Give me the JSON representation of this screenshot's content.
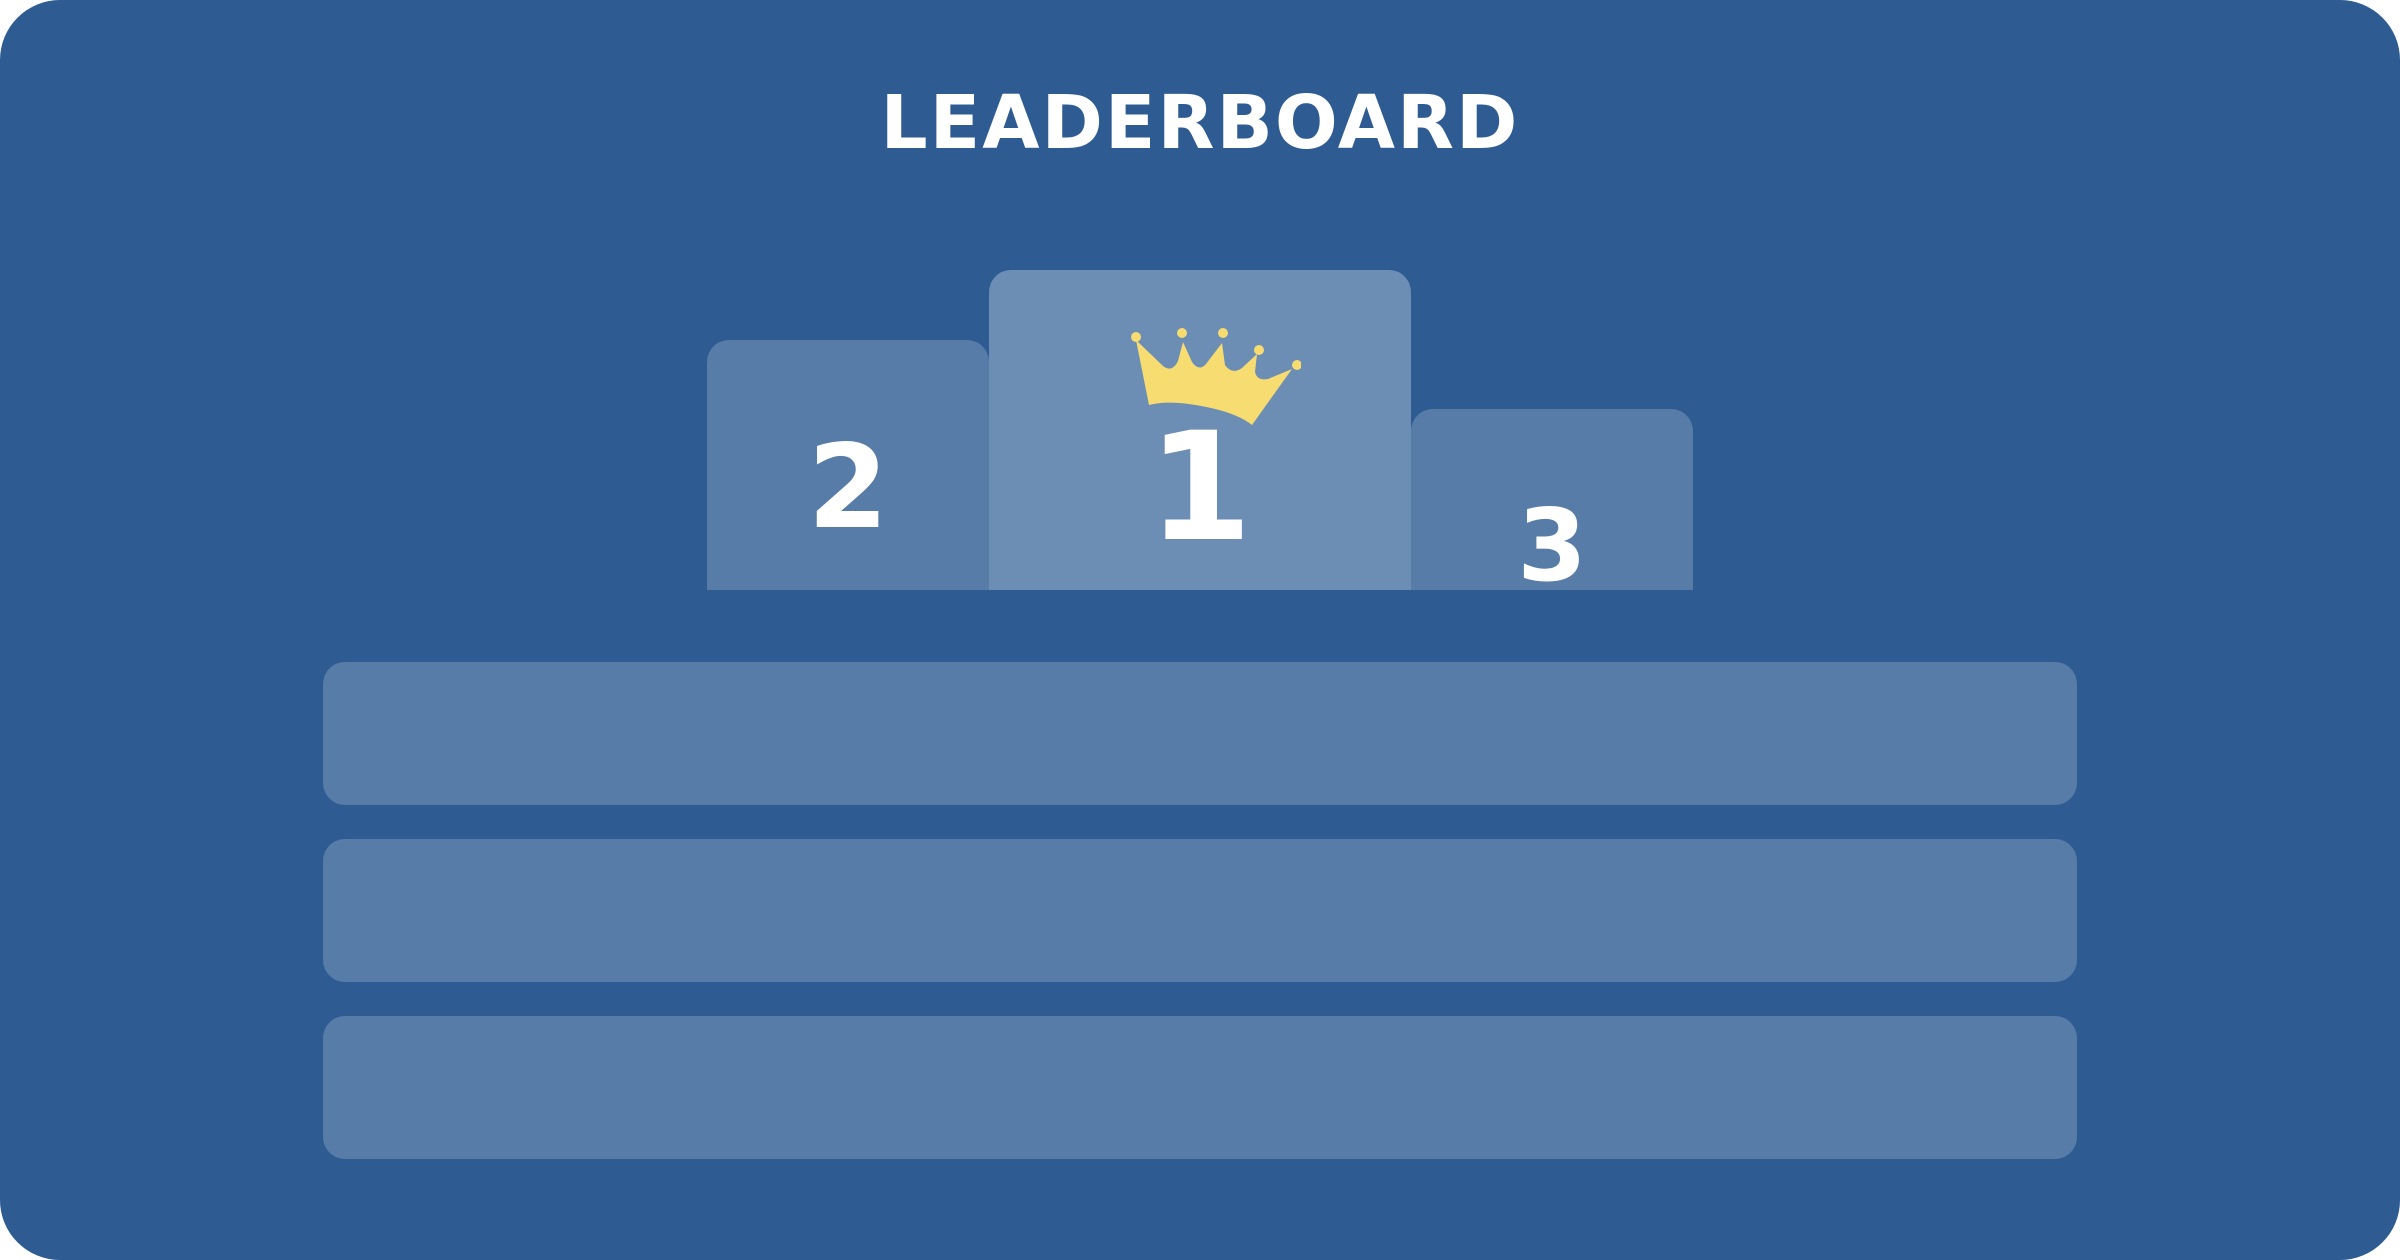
{
  "header": {
    "title": "LEADERBOARD"
  },
  "podium": [
    {
      "rank": "2",
      "place": "second"
    },
    {
      "rank": "1",
      "place": "first",
      "icon": "crown-icon"
    },
    {
      "rank": "3",
      "place": "third"
    }
  ],
  "list": {
    "rows": [
      {},
      {},
      {}
    ]
  },
  "colors": {
    "background": "#2d5b92",
    "podium_side": "#577ca8",
    "podium_center": "#6c8db4",
    "row": "#577ca8",
    "crown": "#f7dc72",
    "text": "#ffffff"
  }
}
